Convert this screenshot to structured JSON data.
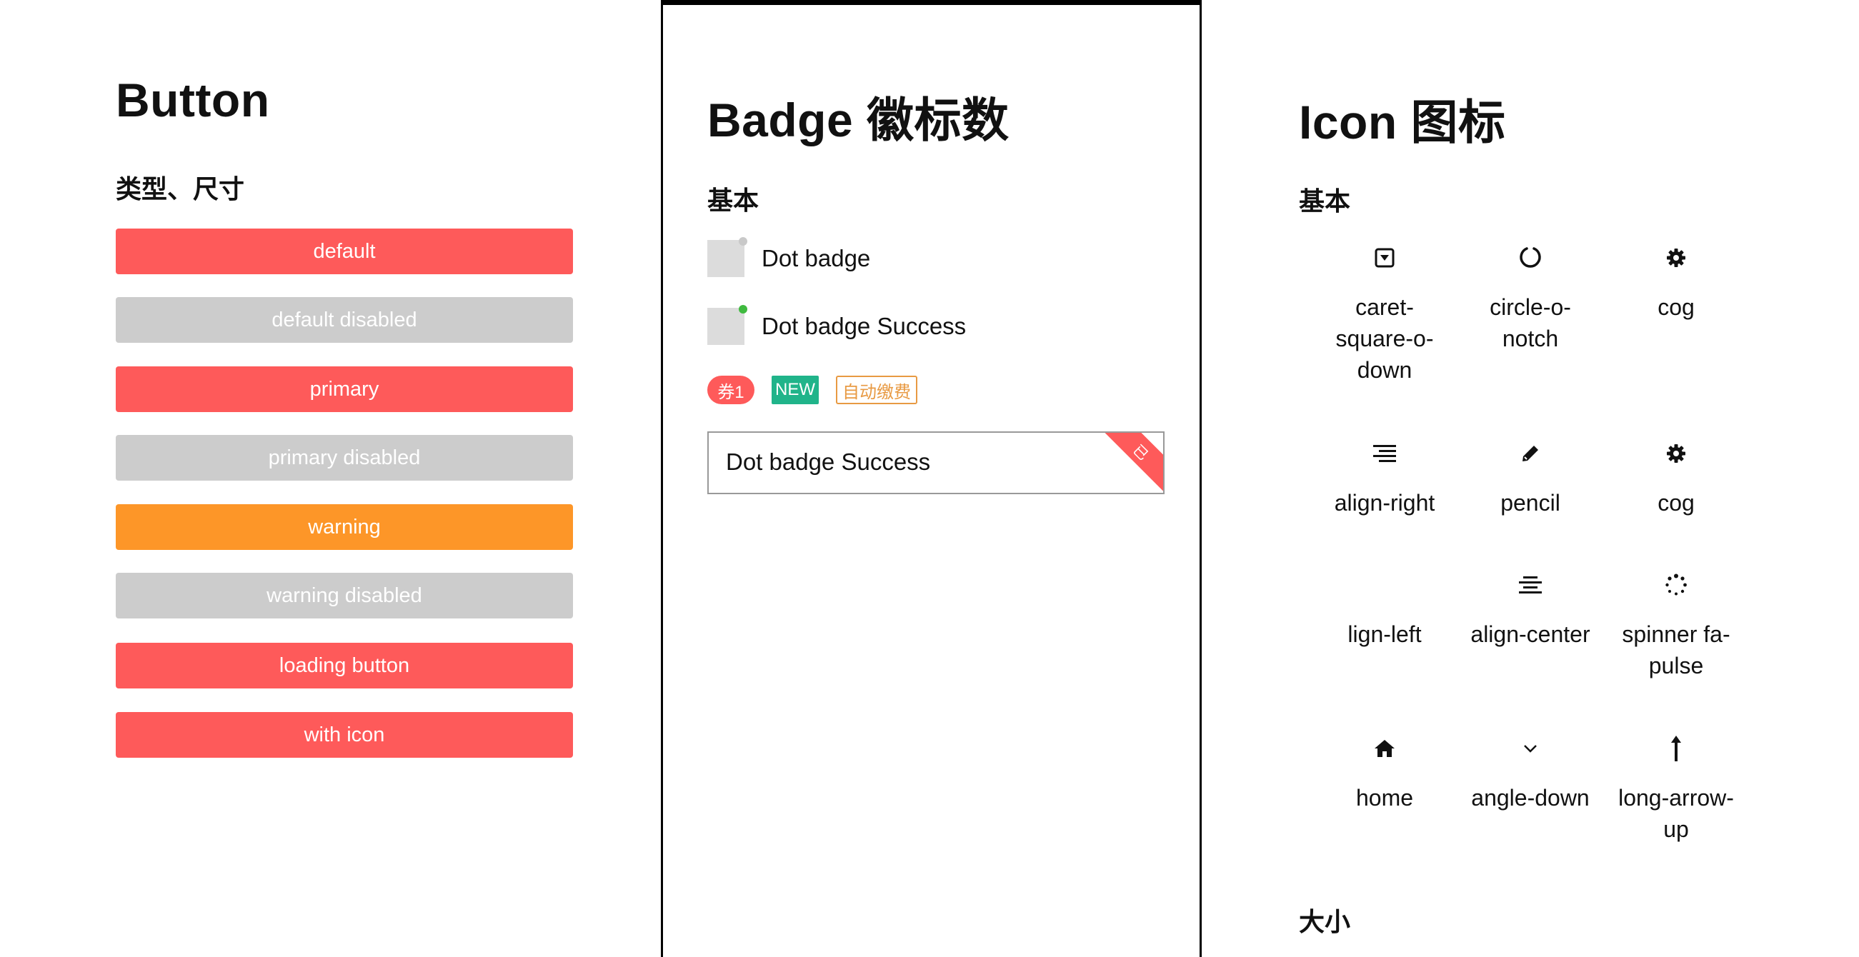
{
  "colors": {
    "primary": "#fe5a5a",
    "disabled": "#cccccc",
    "warning": "#fd9628",
    "success": "#3fba3f",
    "teal": "#20b48a",
    "orange_outline": "#e89a43"
  },
  "button_panel": {
    "title": "Button",
    "section": "类型、尺寸",
    "buttons": [
      {
        "label": "default",
        "variant": "primary"
      },
      {
        "label": "default disabled",
        "variant": "disabled"
      },
      {
        "label": "primary",
        "variant": "primary"
      },
      {
        "label": "primary disabled",
        "variant": "disabled"
      },
      {
        "label": "warning",
        "variant": "warning"
      },
      {
        "label": "warning disabled",
        "variant": "disabled"
      },
      {
        "label": "loading button",
        "variant": "primary"
      },
      {
        "label": "with icon",
        "variant": "primary"
      }
    ]
  },
  "badge_panel": {
    "title": "Badge 徽标数",
    "section": "基本",
    "dot_badges": [
      {
        "label": "Dot badge",
        "dot_color": "#c9c9c9"
      },
      {
        "label": "Dot badge Success",
        "dot_color": "#3fba3f"
      }
    ],
    "tags": [
      {
        "label": "券1",
        "style": "pill-red"
      },
      {
        "label": "NEW",
        "style": "teal"
      },
      {
        "label": "自动缴费",
        "style": "orange-outline"
      }
    ],
    "corner_box": {
      "text": "Dot badge Success",
      "ribbon": "已"
    }
  },
  "icon_panel": {
    "title": "Icon 图标",
    "section_basic": "基本",
    "section_size": "大小",
    "icons": [
      {
        "icon": "caret-square-o-down-icon",
        "label": "caret-\nsquare-o-\ndown"
      },
      {
        "icon": "circle-o-notch-icon",
        "label": "circle-o-\nnotch"
      },
      {
        "icon": "cog-icon",
        "label": "cog"
      },
      {
        "icon": "align-right-icon",
        "label": "align-right"
      },
      {
        "icon": "pencil-icon",
        "label": "pencil"
      },
      {
        "icon": "cog-icon",
        "label": "cog"
      },
      {
        "icon": "align-left-icon",
        "label": "lign-left"
      },
      {
        "icon": "align-center-icon",
        "label": "align-center"
      },
      {
        "icon": "spinner-icon",
        "label": "spinner fa-\npulse"
      },
      {
        "icon": "home-icon",
        "label": "home"
      },
      {
        "icon": "angle-down-icon",
        "label": "angle-down"
      },
      {
        "icon": "long-arrow-up-icon",
        "label": "long-arrow-\nup"
      }
    ]
  }
}
